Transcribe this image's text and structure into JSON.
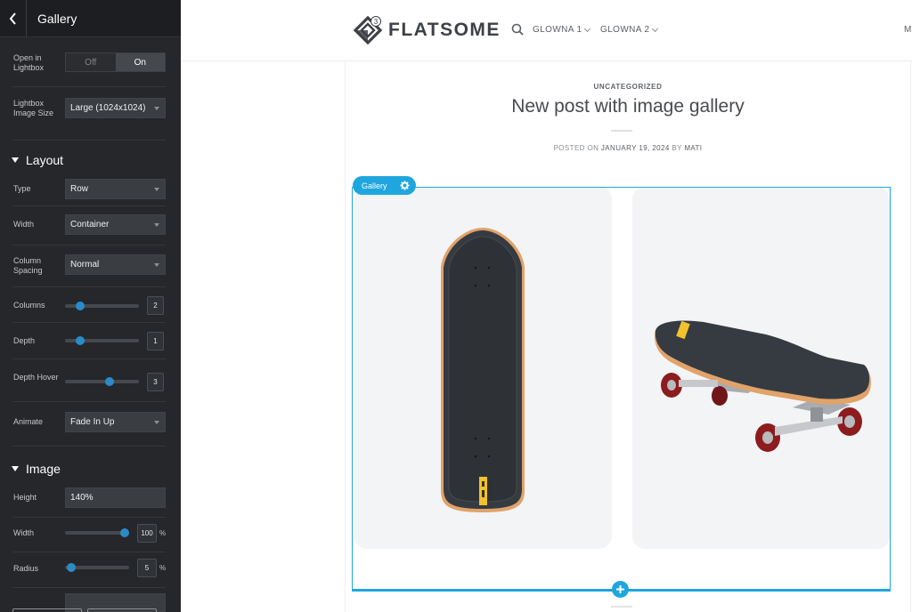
{
  "sidebar": {
    "title": "Gallery",
    "open_in_lightbox": {
      "label": "Open in Lightbox",
      "options": [
        "Off",
        "On"
      ],
      "selected": "On"
    },
    "lightbox_image_size": {
      "label": "Lightbox Image Size",
      "value": "Large (1024x1024)"
    },
    "layout": {
      "heading": "Layout",
      "type": {
        "label": "Type",
        "value": "Row"
      },
      "width": {
        "label": "Width",
        "value": "Container"
      },
      "column_spacing": {
        "label": "Column Spacing",
        "value": "Normal"
      },
      "columns": {
        "label": "Columns",
        "value": "2",
        "level": 0.2
      },
      "depth": {
        "label": "Depth",
        "value": "1",
        "level": 0.2
      },
      "depth_hover": {
        "label": "Depth Hover",
        "value": "3",
        "level": 0.6
      },
      "animate": {
        "label": "Animate",
        "value": "Fade In Up"
      }
    },
    "image": {
      "heading": "Image",
      "height": {
        "label": "Height",
        "value": "140%"
      },
      "width": {
        "label": "Width",
        "value": "100",
        "unit": "%",
        "level": 1.0
      },
      "radius": {
        "label": "Radius",
        "value": "5",
        "unit": "%",
        "level": 0.1
      }
    }
  },
  "site": {
    "logo_text": "FLATSOME",
    "logo_badge": "3",
    "nav": [
      {
        "label": "GLOWNA 1"
      },
      {
        "label": "GLOWNA 2"
      }
    ],
    "nav_cut": "M"
  },
  "post": {
    "category": "UNCATEGORIZED",
    "title": "New post with image gallery",
    "meta_prefix": "POSTED ON",
    "meta_date": "JANUARY 19, 2024",
    "meta_by": "BY",
    "meta_author": "MATI"
  },
  "gallery": {
    "badge_label": "Gallery",
    "images": [
      "skateboard-top-view",
      "skateboard-side-view"
    ]
  },
  "colors": {
    "accent": "#1fa6de",
    "sidebar_bg": "#25272b",
    "slider": "#2a8bc8",
    "board_grip": "#363b41",
    "board_wood": "#e0a36a",
    "wheel": "#8c1c1e",
    "label_yellow": "#f2c12e"
  }
}
